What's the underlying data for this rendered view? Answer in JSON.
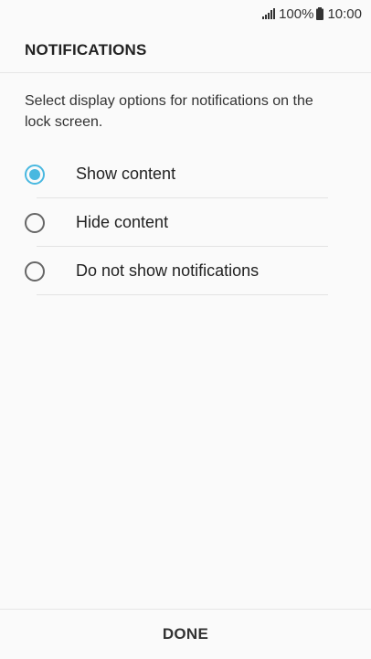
{
  "status_bar": {
    "signal_icon": "signal-icon",
    "battery_level": "100%",
    "battery_icon": "battery-icon",
    "time": "10:00"
  },
  "header": {
    "title": "NOTIFICATIONS"
  },
  "description": "Select display options for notifications on the lock screen.",
  "options": [
    {
      "label": "Show content",
      "selected": true
    },
    {
      "label": "Hide content",
      "selected": false
    },
    {
      "label": "Do not show notifications",
      "selected": false
    }
  ],
  "footer": {
    "done_label": "DONE"
  },
  "colors": {
    "accent": "#49b8e0",
    "background": "#fafafa"
  }
}
